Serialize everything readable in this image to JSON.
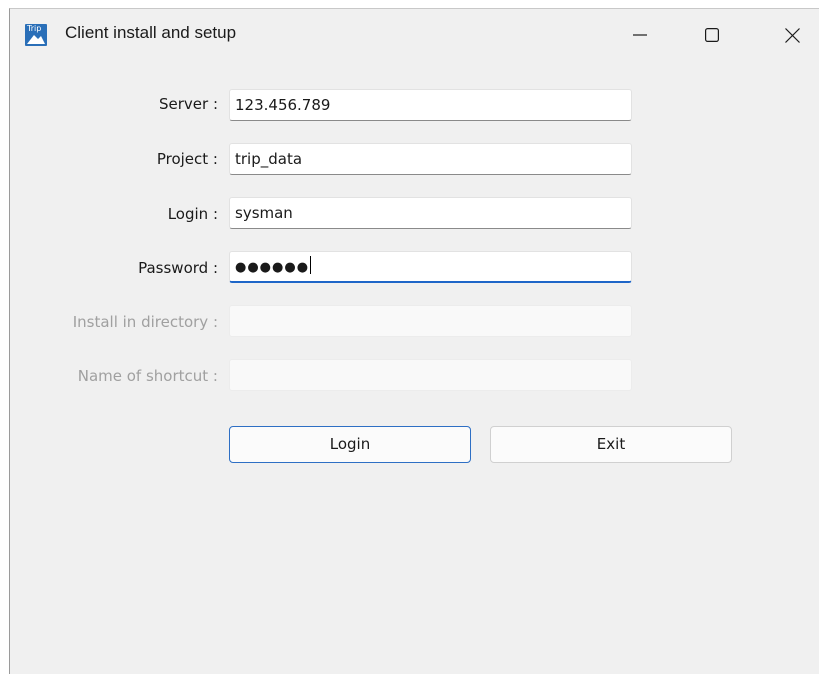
{
  "window": {
    "title": "Client install and setup",
    "app_icon_text": "Trip",
    "controls": {
      "minimize": "—",
      "maximize": "☐",
      "close": "✕"
    }
  },
  "form": {
    "server": {
      "label": "Server :",
      "value": "123.456.789"
    },
    "project": {
      "label": "Project :",
      "value": "trip_data"
    },
    "login": {
      "label": "Login :",
      "value": "sysman"
    },
    "password": {
      "label": "Password :",
      "value": "●●●●●●"
    },
    "install_dir": {
      "label": "Install in directory :",
      "value": ""
    },
    "shortcut": {
      "label": "Name of shortcut :",
      "value": ""
    }
  },
  "buttons": {
    "login": "Login",
    "exit": "Exit"
  },
  "colors": {
    "accent": "#1e66c8",
    "background": "#f0f0f0",
    "disabled_text": "#a0a0a0"
  }
}
